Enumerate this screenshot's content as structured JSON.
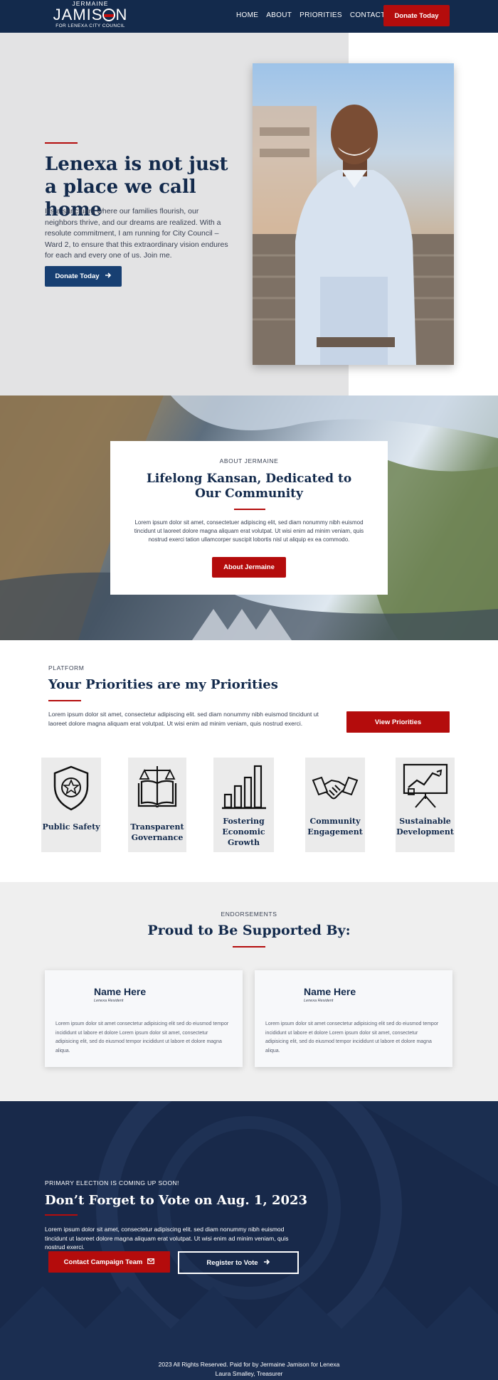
{
  "header": {
    "logo_top": "JERMAINE",
    "logo_name_a": "JAMIS",
    "logo_name_b": "N",
    "logo_sub": "FOR LENEXA CITY COUNCIL",
    "nav": [
      "HOME",
      "ABOUT",
      "PRIORITIES",
      "CONTACT"
    ],
    "donate_label": "Donate Today"
  },
  "hero": {
    "title": "Lenexa is not just a place we call home",
    "text": "It’s a sanctuary where our families flourish, our neighbors thrive, and our dreams are realized. With a resolute commitment, I am running for City Council – Ward 2, to ensure that this extraordinary vision endures for each and every one of us. Join me.",
    "donate_label": "Donate Today"
  },
  "about": {
    "eyebrow": "ABOUT JERMAINE",
    "title": "Lifelong Kansan, Dedicated to Our Community",
    "text": "Lorem ipsum dolor sit amet, consectetuer adipiscing elit, sed diam nonummy nibh euismod tincidunt ut laoreet dolore magna aliquam erat volutpat. Ut wisi enim ad minim veniam, quis nostrud exerci tation ullamcorper suscipit lobortis nisl ut aliquip ex ea commodo.",
    "button": "About Jermaine"
  },
  "priorities": {
    "eyebrow": "PLATFORM",
    "title": "Your Priorities are my Priorities",
    "text": "Lorem ipsum dolor sit amet, consectetur adipiscing elit. sed diam nonummy nibh euismod tincidunt ut laoreet dolore magna aliquam erat volutpat. Ut wisi enim ad minim veniam, quis nostrud exerci.",
    "button": "View Priorities",
    "cards": [
      {
        "label": "Public Safety",
        "icon": "shield-star-icon"
      },
      {
        "label": "Transparent Governance",
        "icon": "scales-book-icon"
      },
      {
        "label": "Fostering Economic Growth",
        "icon": "bar-chart-icon"
      },
      {
        "label": "Community Engagement",
        "icon": "handshake-icon"
      },
      {
        "label": "Sustainable Development",
        "icon": "presentation-chart-icon"
      }
    ]
  },
  "endorsements": {
    "eyebrow": "ENDORSEMENTS",
    "title": "Proud to Be Supported By:",
    "items": [
      {
        "name": "Name Here",
        "role": "Lenexa Resident",
        "text": "Lorem ipsum dolor sit amet consectetur adipisicing elit sed do eiusmod tempor incididunt ut labore et dolore Lorem ipsum dolor sit amet, consectetur adipisicing elit, sed do eiusmod tempor incididunt ut labore et dolore magna aliqua."
      },
      {
        "name": "Name Here",
        "role": "Lenexa Resident",
        "text": "Lorem ipsum dolor sit amet consectetur adipisicing elit sed do eiusmod tempor incididunt ut labore et dolore Lorem ipsum dolor sit amet, consectetur adipisicing elit, sed do eiusmod tempor incididunt ut labore et dolore magna aliqua."
      }
    ]
  },
  "cta": {
    "eyebrow": "PRIMARY ELECTION IS COMING UP SOON!",
    "title": "Don’t Forget to Vote on Aug. 1, 2023",
    "text": "Lorem ipsum dolor sit amet, consectetur adipiscing elit. sed diam nonummy nibh euismod tincidunt ut laoreet dolore magna aliquam erat volutpat. Ut wisi enim ad minim veniam, quis nostrud exerci.",
    "contact_label": "Contact Campaign Team",
    "register_label": "Register to Vote"
  },
  "footer": {
    "line1": "2023 All Rights Reserved. Paid for by Jermaine Jamison for Lenexa",
    "line2": "Laura Smalley, Treasurer"
  },
  "colors": {
    "navy": "#132a4c",
    "red": "#b40c0c",
    "light_gray": "#e3e3e4"
  }
}
